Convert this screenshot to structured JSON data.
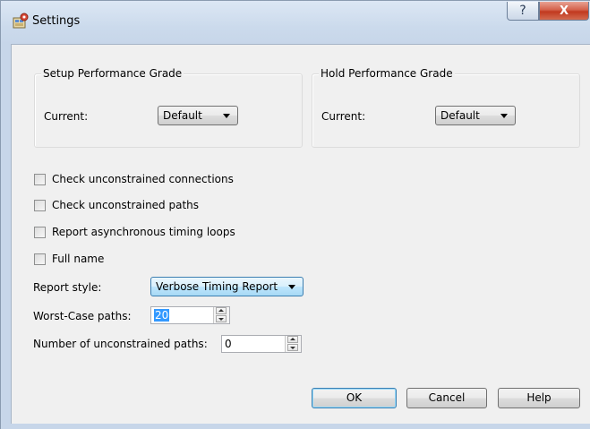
{
  "window": {
    "title": "Settings",
    "help_glyph": "?",
    "close_glyph": "X",
    "icon": "settings-app-icon"
  },
  "setup_grade": {
    "title": "Setup Performance Grade",
    "current_label": "Current:",
    "current_value": "Default"
  },
  "hold_grade": {
    "title": "Hold Performance Grade",
    "current_label": "Current:",
    "current_value": "Default"
  },
  "options": [
    {
      "label": "Check unconstrained connections",
      "checked": false
    },
    {
      "label": "Check unconstrained paths",
      "checked": false
    },
    {
      "label": "Report asynchronous timing loops",
      "checked": false
    },
    {
      "label": "Full name",
      "checked": false
    }
  ],
  "report_style": {
    "label": "Report style:",
    "value": "Verbose Timing Report"
  },
  "worst_case": {
    "label": "Worst-Case paths:",
    "value": "20"
  },
  "unconstrained": {
    "label": "Number of unconstrained paths:",
    "value": "0"
  },
  "buttons": {
    "ok": "OK",
    "cancel": "Cancel",
    "help": "Help"
  }
}
